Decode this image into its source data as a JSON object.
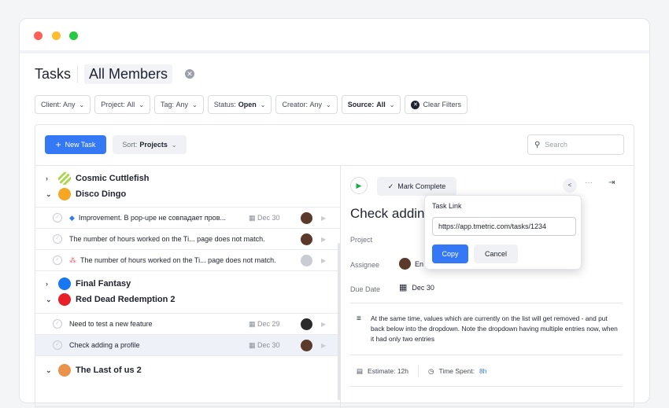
{
  "header": {
    "title": "Tasks",
    "scope": "All Members"
  },
  "filters": [
    {
      "label": "Client:",
      "value": "Any"
    },
    {
      "label": "Project:",
      "value": "All"
    },
    {
      "label": "Tag:",
      "value": "Any"
    },
    {
      "label": "Status:",
      "value": "Open"
    },
    {
      "label": "Creator:",
      "value": "Any"
    },
    {
      "label": "Source:",
      "value": "All"
    }
  ],
  "clear_filters": "Clear Filters",
  "toolbar": {
    "new_task": "New Task",
    "sort_label": "Sort:",
    "sort_value": "Projects",
    "search_placeholder": "Search"
  },
  "groups": [
    {
      "name": "Cosmic Cuttlefish",
      "color": "#a8d84a",
      "expanded": false
    },
    {
      "name": "Disco Dingo",
      "color": "#f5a623",
      "expanded": true
    },
    {
      "name": "Final Fantasy",
      "color": "#1877f2",
      "expanded": false
    },
    {
      "name": "Red Dead Redemption 2",
      "color": "#e8202a",
      "expanded": true
    },
    {
      "name": "The Last of us 2",
      "color": "#e8924a",
      "expanded": true
    }
  ],
  "tasks": [
    {
      "title": "Improvement. В pop-upe не совпадает пров...",
      "date": "Dec 30",
      "tag_icon": "diamond-icon"
    },
    {
      "title": "The number of hours worked on the Ti... page does not match.",
      "date": ""
    },
    {
      "title": "The number of hours worked on the Ti... page does not match.",
      "date": "",
      "tag_icon": "asana-icon"
    },
    {
      "title": "Need to test a new feature",
      "date": "Dec 29"
    },
    {
      "title": "Check adding a profile",
      "date": "Dec 30"
    }
  ],
  "detail": {
    "mark_complete": "Mark Complete",
    "title": "Check adding",
    "project_label": "Project",
    "assignee_label": "Assignee",
    "assignee_value": "En",
    "due_label": "Due Date",
    "due_value": "Dec 30",
    "description": "At the same time, values which are currently on the list will get removed - and put back below into the dropdown. Note the dropdown having multiple entries now, when it had only two entries",
    "estimate": "Estimate: 12h",
    "time_spent_label": "Time Spent:",
    "time_spent_value": "8h"
  },
  "popup": {
    "title": "Task Link",
    "url": "https://app.tmetric.com/tasks/1234",
    "copy": "Copy",
    "cancel": "Cancel"
  }
}
